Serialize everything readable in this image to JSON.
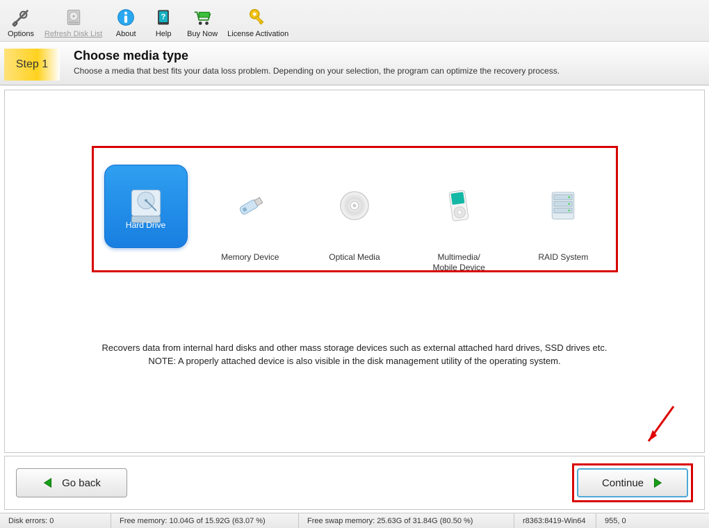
{
  "toolbar": {
    "items": [
      {
        "label": "Options",
        "icon": "wrench-screwdriver",
        "enabled": true
      },
      {
        "label": "Refresh Disk List",
        "icon": "hard-disk-gray",
        "enabled": false
      },
      {
        "label": "About",
        "icon": "info-circle",
        "enabled": true
      },
      {
        "label": "Help",
        "icon": "help-book",
        "enabled": true
      },
      {
        "label": "Buy Now",
        "icon": "shopping-cart",
        "enabled": true
      },
      {
        "label": "License Activation",
        "icon": "key",
        "enabled": true
      }
    ]
  },
  "step": {
    "badge": "Step 1",
    "title": "Choose media type",
    "desc": "Choose a media that best fits your data loss problem. Depending on your selection, the program can optimize the recovery process."
  },
  "media": {
    "items": [
      {
        "label": "Hard Drive",
        "icon": "hard-drive",
        "selected": true
      },
      {
        "label": "Memory Device",
        "icon": "usb-stick",
        "selected": false
      },
      {
        "label": "Optical Media",
        "icon": "optical-disc",
        "selected": false
      },
      {
        "label": "Multimedia/\nMobile Device",
        "icon": "ipod",
        "selected": false
      },
      {
        "label": "RAID System",
        "icon": "raid-stack",
        "selected": false
      }
    ],
    "description": "Recovers data from internal hard disks and other mass storage devices such as external attached hard drives, SSD drives etc.\nNOTE: A properly attached device is also visible in the disk management utility of the operating system."
  },
  "buttons": {
    "back": "Go back",
    "continue": "Continue"
  },
  "status": {
    "errors": "Disk errors: 0",
    "free_mem": "Free memory: 10.04G of 15.92G (63.07 %)",
    "free_swap": "Free swap memory: 25.63G of 31.84G (80.50 %)",
    "build": "r8363:8419-Win64",
    "coords": "955, 0"
  },
  "annotations": {
    "media_box_highlight_color": "#d80000",
    "continue_highlight_color": "#d80000"
  }
}
